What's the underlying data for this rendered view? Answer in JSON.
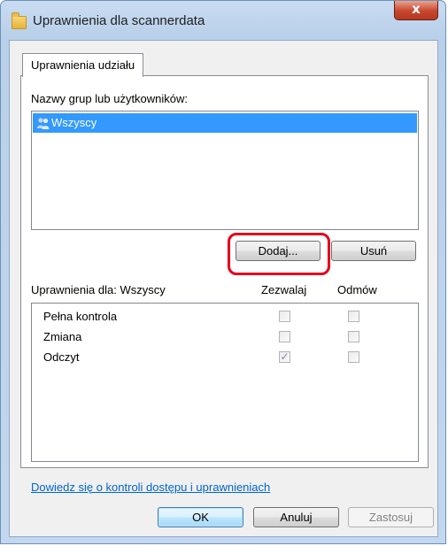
{
  "window": {
    "title": "Uprawnienia dla scannerdata",
    "close_label": "x"
  },
  "tabs": [
    {
      "label": "Uprawnienia udziału",
      "active": true
    }
  ],
  "groups": {
    "label": "Nazwy grup lub użytkowników:",
    "items": [
      {
        "name": "Wszyscy",
        "selected": true,
        "icon": "users-icon"
      }
    ],
    "add_button": "Dodaj...",
    "remove_button": "Usuń"
  },
  "permissions": {
    "header_label": "Uprawnienia dla: Wszyscy",
    "allow_header": "Zezwalaj",
    "deny_header": "Odmów",
    "rows": [
      {
        "name": "Pełna kontrola",
        "allow": false,
        "deny": false
      },
      {
        "name": "Zmiana",
        "allow": false,
        "deny": false
      },
      {
        "name": "Odczyt",
        "allow": true,
        "deny": false
      }
    ]
  },
  "help_link": "Dowiedz się o kontroli dostępu i uprawnieniach",
  "footer": {
    "ok": "OK",
    "cancel": "Anuluj",
    "apply": "Zastosuj"
  },
  "colors": {
    "selection": "#3399ff",
    "highlight_annotation": "#e4001b",
    "link": "#0066cc"
  }
}
